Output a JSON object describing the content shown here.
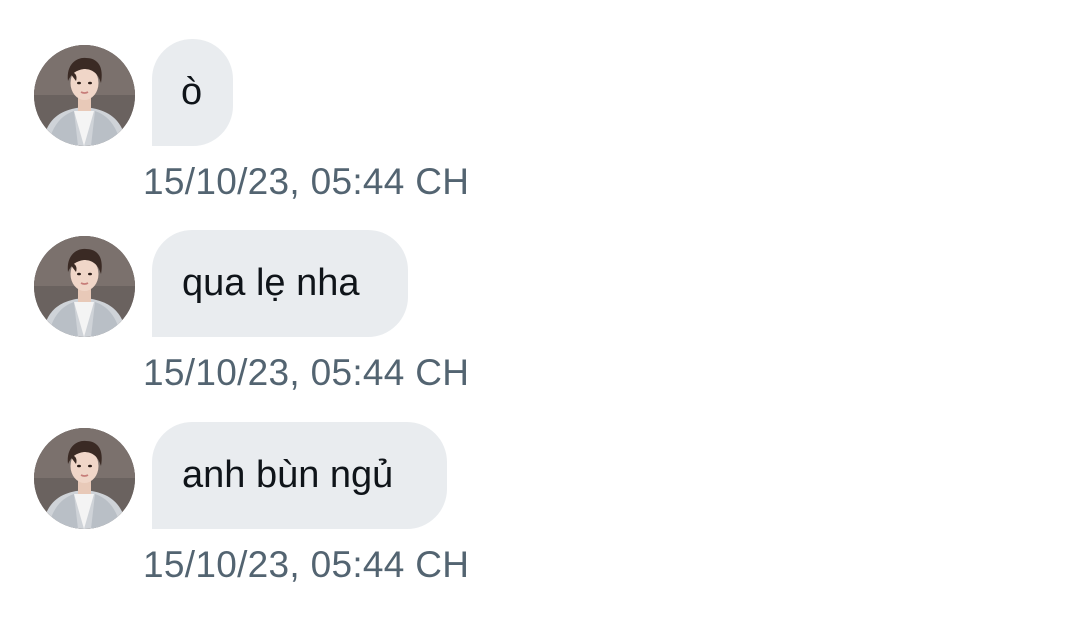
{
  "conversation": {
    "messages": [
      {
        "text": "ò",
        "timestamp": "15/10/23, 05:44 CH",
        "avatar_icon": "user-avatar-photo"
      },
      {
        "text": "qua lẹ nha",
        "timestamp": "15/10/23, 05:44 CH",
        "avatar_icon": "user-avatar-photo"
      },
      {
        "text": "anh bùn ngủ",
        "timestamp": "15/10/23, 05:44 CH",
        "avatar_icon": "user-avatar-photo"
      }
    ]
  },
  "colors": {
    "bubble_background": "#e9ecef",
    "message_text": "#0f1419",
    "timestamp_text": "#536471",
    "page_background": "#ffffff"
  }
}
